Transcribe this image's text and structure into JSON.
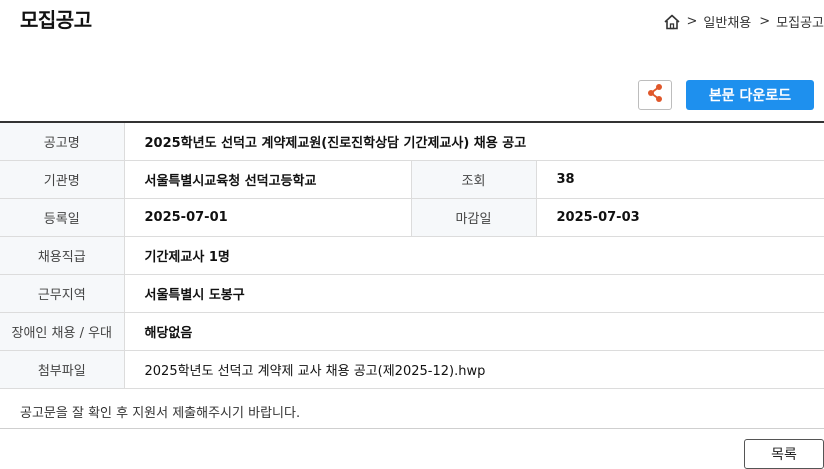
{
  "page_title": "모집공고",
  "breadcrumb": {
    "sep": ">",
    "level1": "일반채용",
    "level2": "모집공고"
  },
  "actions": {
    "download_label": "본문 다운로드"
  },
  "colors": {
    "accent": "#1e90ee",
    "share_icon": "#e0572a"
  },
  "info": {
    "title_label": "공고명",
    "title_value": "2025학년도 선덕고 계약제교원(진로진학상담 기간제교사) 채용 공고",
    "org_label": "기관명",
    "org_value": "서울특별시교육청 선덕고등학교",
    "views_label": "조회",
    "views_value": "38",
    "reg_label": "등록일",
    "reg_value": "2025-07-01",
    "deadline_label": "마감일",
    "deadline_value": "2025-07-03",
    "grade_label": "채용직급",
    "grade_value": "기간제교사 1명",
    "region_label": "근무지역",
    "region_value": "서울특별시 도봉구",
    "disability_label": "장애인 채용 / 우대",
    "disability_value": "해당없음",
    "attach_label": "첨부파일",
    "attach_value": "2025학년도 선덕고 계약제 교사 채용 공고(제2025-12).hwp"
  },
  "notice": "공고문을 잘 확인 후 지원서 제출해주시기 바랍니다.",
  "list_label": "목록"
}
